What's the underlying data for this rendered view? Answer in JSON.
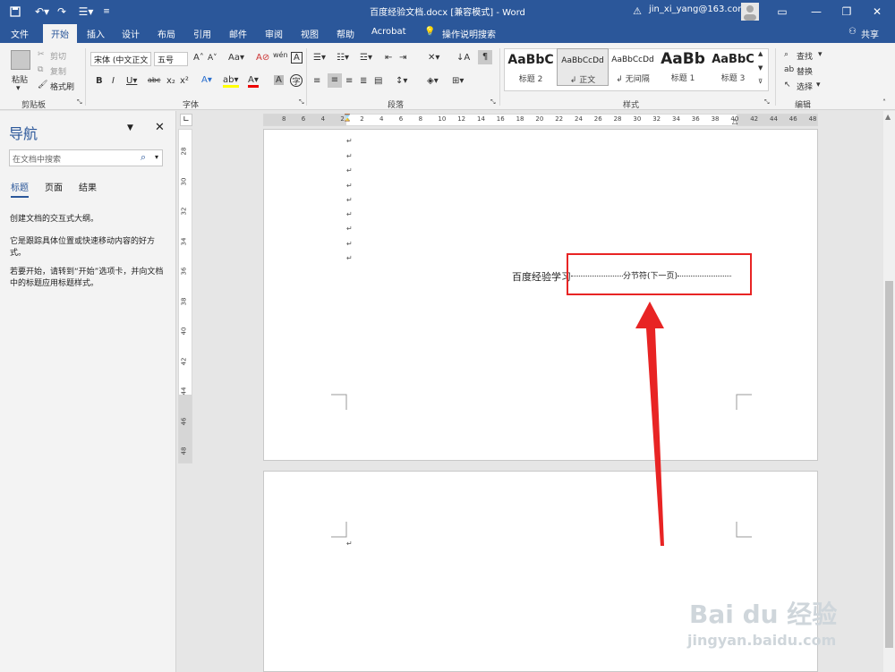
{
  "titlebar": {
    "title": "百度经验文档.docx [兼容模式]  -  Word",
    "user": "jin_xi_yang@163.com",
    "icons": [
      "save-icon",
      "undo-icon",
      "redo-icon",
      "list-icon",
      "customize-icon",
      "warning-icon",
      "user-avatar-icon",
      "ribbon-display-icon",
      "minimize-icon",
      "restore-icon",
      "close-icon"
    ]
  },
  "tabs": [
    "文件",
    "开始",
    "插入",
    "设计",
    "布局",
    "引用",
    "邮件",
    "审阅",
    "视图",
    "帮助",
    "Acrobat",
    "操作说明搜索"
  ],
  "active_tab": "开始",
  "share_label": "共享",
  "ribbon": {
    "clipboard": {
      "paste": "粘贴",
      "cut": "剪切",
      "copy": "复制",
      "painter": "格式刷",
      "label": "剪贴板"
    },
    "font": {
      "name": "宋体 (中文正文",
      "size": "五号",
      "label": "字体"
    },
    "paragraph": {
      "label": "段落"
    },
    "styles": {
      "label": "样式",
      "items": [
        {
          "preview": "AaBbC",
          "name": "标题 2"
        },
        {
          "preview": "AaBbCcDd",
          "name": "↲ 正文"
        },
        {
          "preview": "AaBbCcDd",
          "name": "↲ 无间隔"
        },
        {
          "preview": "AaBb",
          "name": "标题 1"
        },
        {
          "preview": "AaBbC",
          "name": "标题 3"
        }
      ]
    },
    "editing": {
      "find": "查找",
      "replace": "替换",
      "select": "选择",
      "label": "编辑"
    }
  },
  "nav": {
    "title": "导航",
    "search_placeholder": "在文档中搜索",
    "tabs": [
      "标题",
      "页面",
      "结果"
    ],
    "text1": "创建文档的交互式大纲。",
    "text2": "它是跟踪具体位置或快速移动内容的好方式。",
    "text3": "若要开始，请转到“开始”选项卡，并向文档中的标题应用标题样式。"
  },
  "ruler": {
    "h_ticks": [
      "8",
      "6",
      "4",
      "2",
      "2",
      "4",
      "6",
      "8",
      "10",
      "12",
      "14",
      "16",
      "18",
      "20",
      "22",
      "24",
      "26",
      "28",
      "30",
      "32",
      "34",
      "36",
      "38",
      "40",
      "42",
      "44",
      "46",
      "48"
    ],
    "v_ticks": [
      "28",
      "30",
      "32",
      "34",
      "36",
      "38",
      "40",
      "42",
      "44",
      "46",
      "48"
    ]
  },
  "document": {
    "line_text": "百度经验学习",
    "section_break": "分节符(下一页)",
    "paragraph_mark": "↵"
  },
  "annotation": {
    "color": "#e82424"
  },
  "watermark": {
    "logo": "Bai du 经验",
    "url": "jingyan.baidu.com"
  },
  "colors": {
    "accent": "#2b579a",
    "ribbon": "#f3f3f3"
  }
}
